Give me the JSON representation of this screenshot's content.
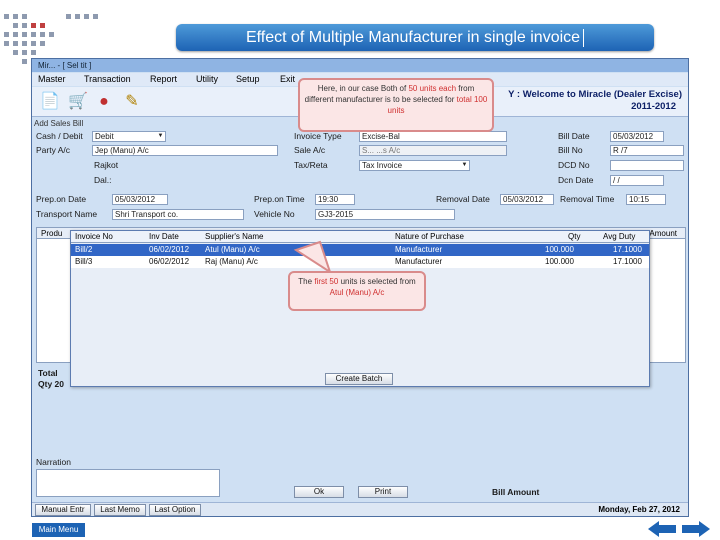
{
  "slide": {
    "title": "Effect of Multiple Manufacturer in single invoice",
    "main_menu_label": "Main Menu"
  },
  "window": {
    "title": "Mir... - [ Sel tit ]",
    "menu": [
      "Master",
      "Transaction",
      "Report",
      "Utility",
      "Setup",
      "Exit"
    ],
    "welcome_line1": "Y : Welcome to Miracle (Dealer Excise)",
    "welcome_line2": "2011-2012",
    "form_title": "Add Sales Bill"
  },
  "form": {
    "cash_debit_label": "Cash / Debit",
    "cash_debit_value": "Debit",
    "party_label": "Party A/c",
    "party_value": "Jep (Manu) A/c",
    "city_value": "Rajkot",
    "dealer_label": "Dal.:",
    "invoice_type_label": "Invoice Type",
    "invoice_type_value": "Excise-Bal",
    "sale_ac_label": "Sale A/c",
    "sale_ac_value": "S... ...s A/c",
    "tax_retail_label": "Tax/Reta",
    "tax_retail_value": "Tax Invoice",
    "bill_date_label": "Bill Date",
    "bill_date_value": "05/03/2012",
    "bill_no_label": "Bill No",
    "bill_no_value": "R /7",
    "dcd_no_label": "DCD No",
    "dcd_date_label": "Dcn Date",
    "dcd_date_value": "/ /",
    "prep_date_label": "Prep.on Date",
    "prep_date_value": "05/03/2012",
    "prep_time_label": "Prep.on Time",
    "prep_time_value": "19:30",
    "removal_date_label": "Removal Date",
    "removal_date_value": "05/03/2012",
    "removal_time_label": "Removal Time",
    "removal_time_value": "10:15",
    "transport_label": "Transport Name",
    "transport_value": "Shri Transport co.",
    "vehicle_label": "Vehicle No",
    "vehicle_value": "GJ3-2015",
    "product_header": "Produ",
    "amount_header": "Amount",
    "total_label": "Total",
    "qty_label": "Qty 20",
    "narration_label": "Narration",
    "bill_amount_label": "Bill Amount",
    "status_date": "Monday, Feb 27, 2012"
  },
  "popup": {
    "columns": [
      "Invoice No",
      "Inv Date",
      "Supplier's Name",
      "Nature of Purchase",
      "Qty",
      "Avg Duty"
    ],
    "rows": [
      {
        "invoice": "Bill/2",
        "date": "06/02/2012",
        "supplier": "Atul (Manu) A/c",
        "nature": "Manufacturer",
        "qty": "100.000",
        "duty": "17.1000"
      },
      {
        "invoice": "Bill/3",
        "date": "06/02/2012",
        "supplier": "Raj (Manu) A/c",
        "nature": "Manufacturer",
        "qty": "100.000",
        "duty": "17.1000"
      }
    ],
    "create_batch_label": "Create Batch"
  },
  "buttons": {
    "ok": "Ok",
    "print": "Print",
    "narration_btn": "Manual Entr",
    "last_memo": "Last Memo",
    "last_option": "Last Option"
  },
  "callouts": {
    "top_pre": "Here, in our case Both of",
    "top_hi1": "50 units each",
    "top_mid": "from different manufacturer is to be selected for",
    "top_hi2": "total 100 units",
    "bottom_pre": "The",
    "bottom_hi1": "first 50",
    "bottom_mid": "units is selected from",
    "bottom_hi2": "Atul (Manu) A/c"
  },
  "colors": {
    "accent": "#1d63b4",
    "selection": "#3166c6",
    "callout_text": "#d03030"
  }
}
